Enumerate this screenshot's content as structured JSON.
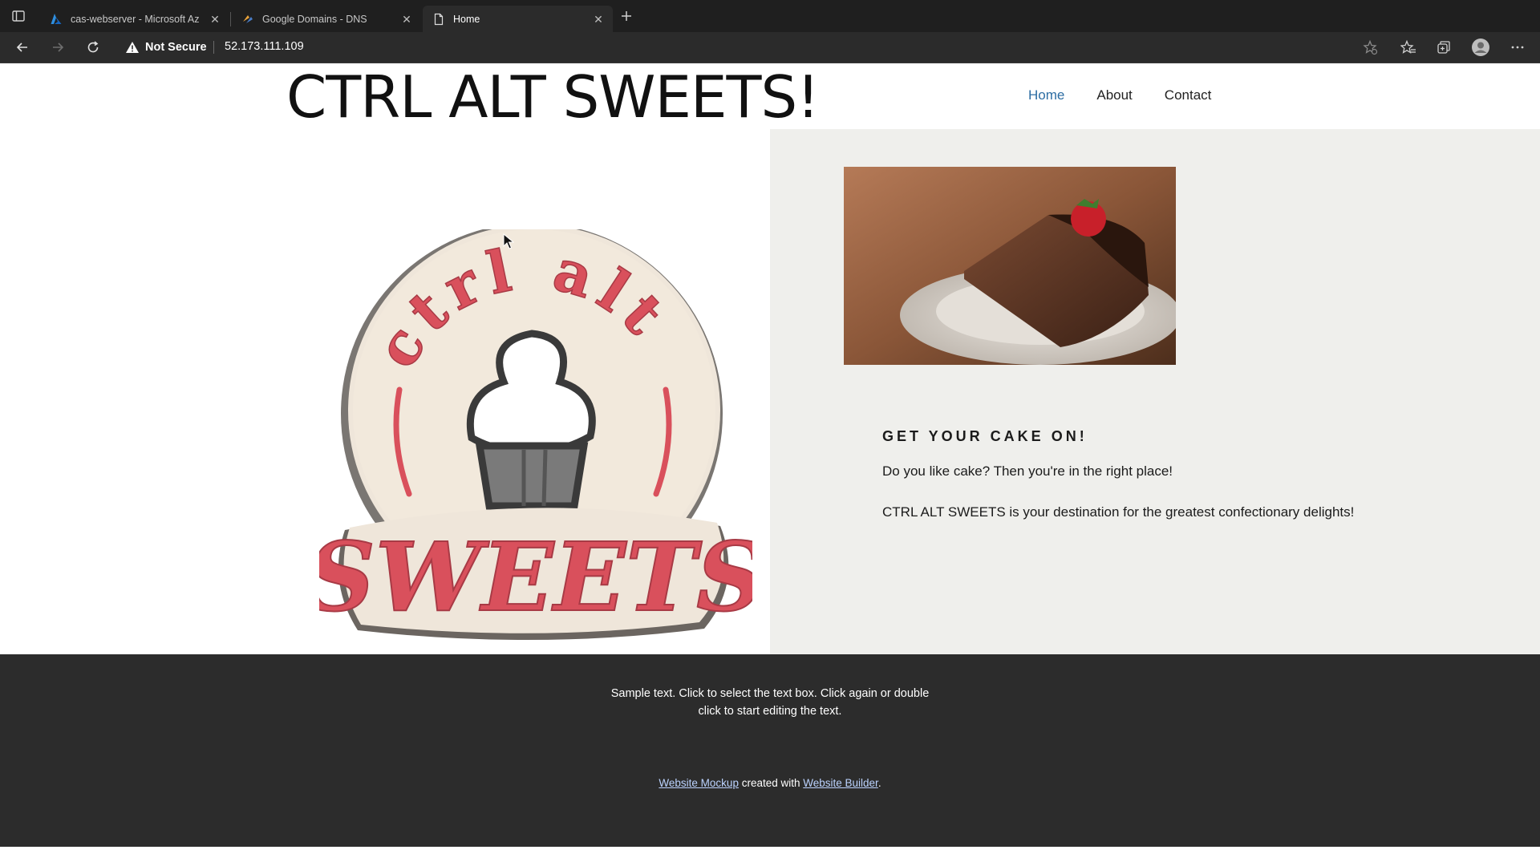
{
  "browser": {
    "tabs": [
      {
        "title": "cas-webserver - Microsoft Az",
        "icon": "azure-icon",
        "active": false
      },
      {
        "title": "Google Domains - DNS",
        "icon": "google-domains-icon",
        "active": false
      },
      {
        "title": "Home",
        "icon": "page-icon",
        "active": true
      }
    ],
    "security_label": "Not Secure",
    "url": "52.173.111.109"
  },
  "site": {
    "title": "CTRL ALT SWEETS!",
    "nav": [
      {
        "label": "Home",
        "current": true
      },
      {
        "label": "About",
        "current": false
      },
      {
        "label": "Contact",
        "current": false
      }
    ],
    "logo": {
      "top_text": "ctrl alt",
      "bottom_text": "SWEETS"
    },
    "image": "chocolate-cake-slice-with-strawberry",
    "section": {
      "heading": "GET YOUR CAKE ON!",
      "p1": "Do you like cake? Then you're in the right place!",
      "p2": "CTRL ALT SWEETS is your destination for the greatest confectionary delights!"
    },
    "footer": {
      "sample_text": "Sample text. Click to select the text box. Click again or double click to start editing the text.",
      "credit_link1": "Website Mockup",
      "credit_middle": " created with ",
      "credit_link2": "Website Builder",
      "credit_end": "."
    }
  },
  "colors": {
    "nav_current": "#2d6da3",
    "logo_red": "#d9505c",
    "panel_bg": "#efefec",
    "footer_bg": "#2c2c2c"
  }
}
